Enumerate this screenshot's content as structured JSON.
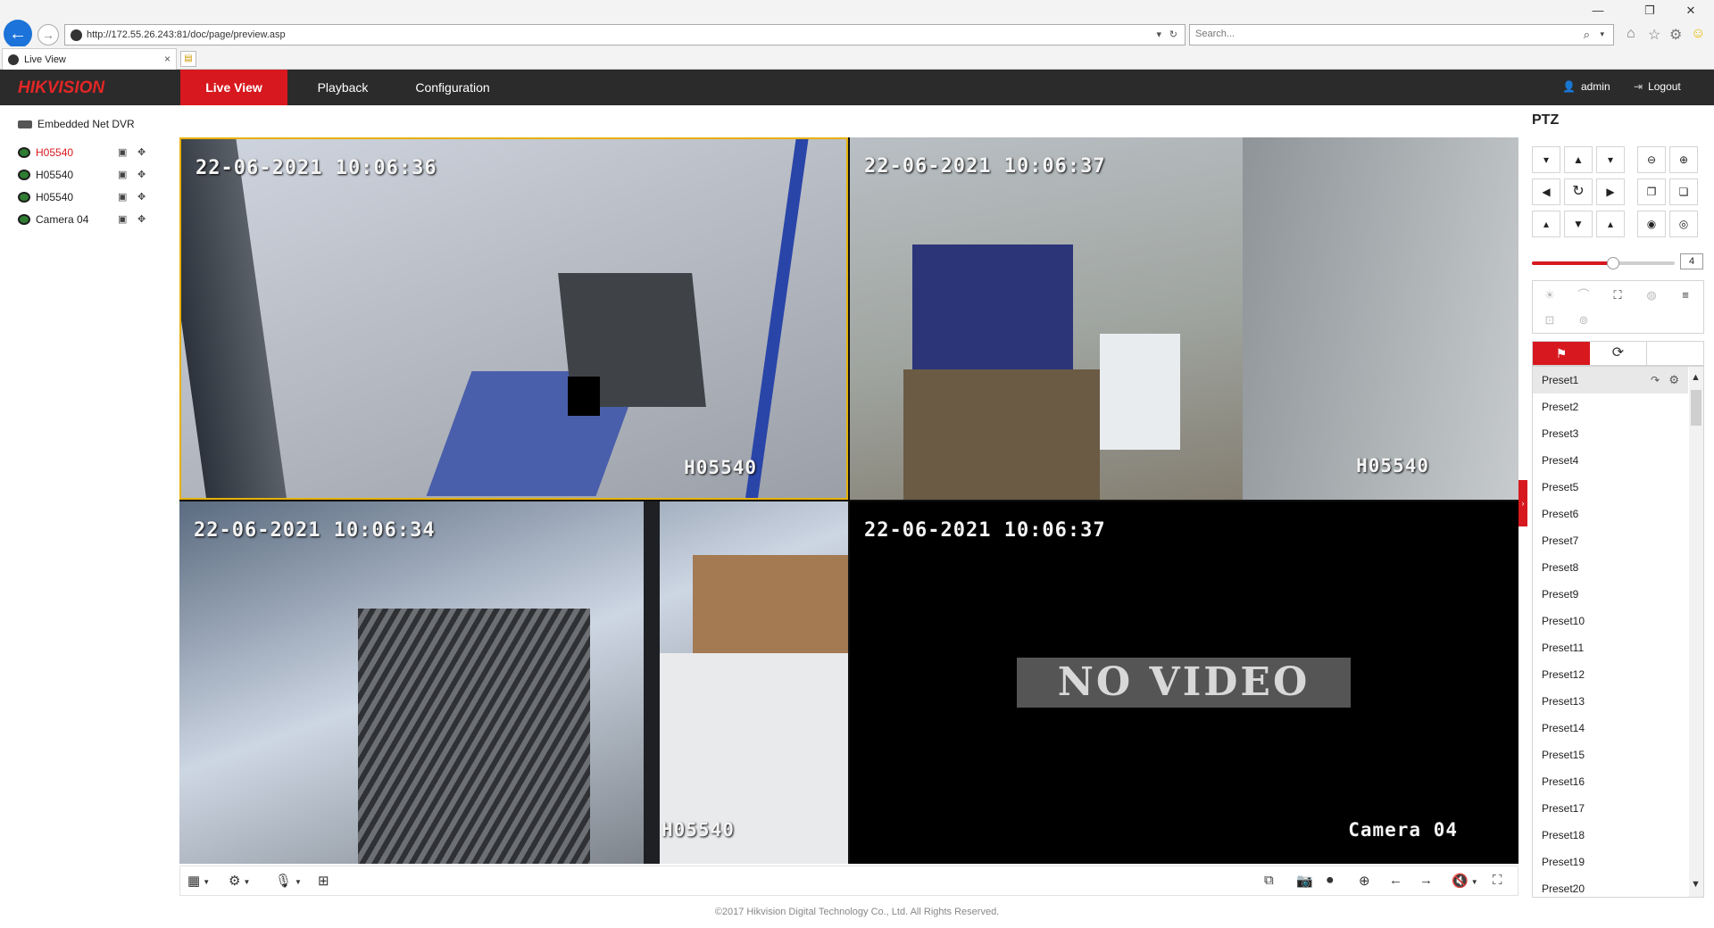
{
  "browser": {
    "url": "http://172.55.26.243:81/doc/page/preview.asp",
    "search_placeholder": "Search...",
    "tab_title": "Live View",
    "tab_close": "×"
  },
  "nav": {
    "logo": "HIKVISION",
    "tabs": [
      "Live View",
      "Playback",
      "Configuration"
    ],
    "user": "admin",
    "logout": "Logout"
  },
  "tree": {
    "root": "Embedded Net DVR",
    "cameras": [
      {
        "name": "H05540",
        "active": true
      },
      {
        "name": "H05540",
        "active": false
      },
      {
        "name": "H05540",
        "active": false
      },
      {
        "name": "Camera 04",
        "active": false
      }
    ]
  },
  "video": {
    "tiles": [
      {
        "timestamp": "22-06-2021 10:06:36",
        "channel": "H05540"
      },
      {
        "timestamp": "22-06-2021 10:06:37",
        "channel": "H05540"
      },
      {
        "timestamp": "22-06-2021 10:06:34",
        "channel": "H05540"
      },
      {
        "timestamp": "22-06-2021 10:06:37",
        "channel": "Camera 04"
      }
    ],
    "no_video": "NO VIDEO"
  },
  "footer": "©2017 Hikvision Digital Technology Co., Ltd. All Rights Reserved.",
  "ptz": {
    "title": "PTZ",
    "speed": 4,
    "speed_max": 7,
    "presets": [
      "Preset1",
      "Preset2",
      "Preset3",
      "Preset4",
      "Preset5",
      "Preset6",
      "Preset7",
      "Preset8",
      "Preset9",
      "Preset10",
      "Preset11",
      "Preset12",
      "Preset13",
      "Preset14",
      "Preset15",
      "Preset16",
      "Preset17",
      "Preset18",
      "Preset19",
      "Preset20"
    ]
  },
  "colors": {
    "accent": "#d7191f",
    "nav_bg": "#2b2b2b",
    "selected_tile_border": "#e7b10a"
  },
  "icons": {
    "layout": "grid-layout-icon",
    "stream": "stream-type-icon",
    "audio": "microphone-icon",
    "snapshot": "camera-icon",
    "record": "record-icon",
    "zoom": "zoom-icon",
    "prev": "arrow-left-icon",
    "next": "arrow-right-icon",
    "volume": "volume-icon",
    "fullscreen": "fullscreen-icon"
  }
}
